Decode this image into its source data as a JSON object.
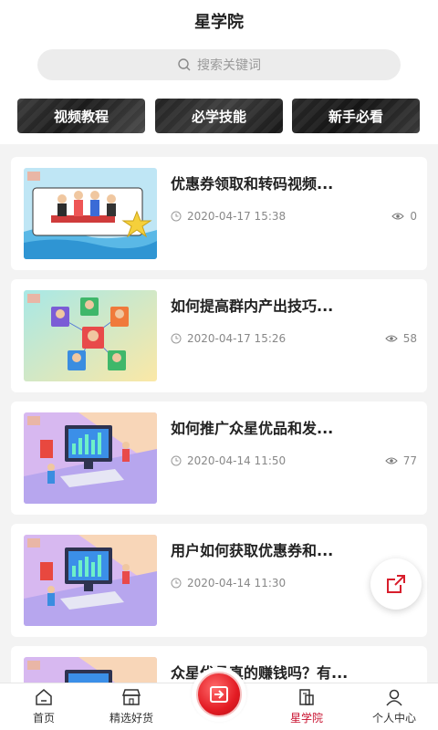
{
  "header": {
    "title": "星学院"
  },
  "search": {
    "placeholder": "搜索关键词"
  },
  "categories": [
    {
      "label": "视频教程"
    },
    {
      "label": "必学技能"
    },
    {
      "label": "新手必看"
    }
  ],
  "articles": [
    {
      "title": "优惠券领取和转码视频...",
      "date": "2020-04-17 15:38",
      "views": "0"
    },
    {
      "title": "如何提高群内产出技巧...",
      "date": "2020-04-17 15:26",
      "views": "58"
    },
    {
      "title": "如何推广众星优品和发...",
      "date": "2020-04-14 11:50",
      "views": "77"
    },
    {
      "title": "用户如何获取优惠券和...",
      "date": "2020-04-14 11:30",
      "views": ""
    },
    {
      "title": "众星优品真的赚钱吗？有...",
      "date": "",
      "views": ""
    }
  ],
  "tabbar": {
    "items": [
      {
        "label": "首页"
      },
      {
        "label": "精选好货"
      },
      {
        "label": "星学院"
      },
      {
        "label": "个人中心"
      }
    ]
  },
  "colors": {
    "accent": "#c8102e",
    "center_button": "#e31b23"
  }
}
